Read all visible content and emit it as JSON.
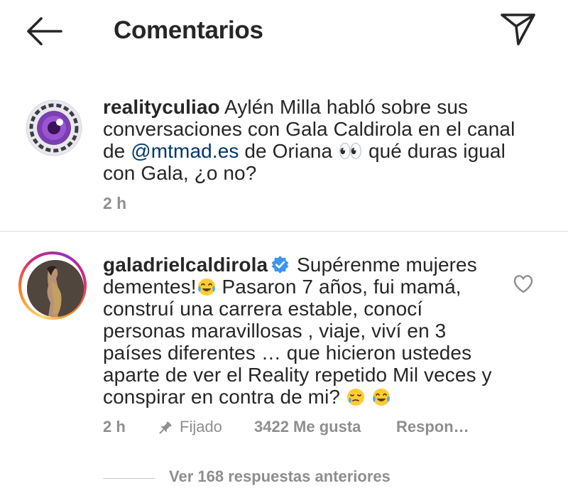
{
  "header": {
    "title": "Comentarios",
    "back_icon": "arrow-left-icon",
    "send_icon": "paper-plane-icon"
  },
  "caption": {
    "username": "realityculiao",
    "text_1": " Aylén Milla habló sobre sus conversaciones con Gala Caldirola en el canal de ",
    "mention": "@mtmad.es",
    "text_2": " de Oriana 👀 qué duras igual con Gala, ¿o no?",
    "time": "2 h"
  },
  "comment": {
    "username": "galadrielcaldirola",
    "verified": true,
    "text_1": " Supérenme mujeres dementes!",
    "text_2": " Pasaron 7 años, fui mamá, construí una carrera estable, conocí personas maravillosas , viaje, viví en 3 países diferentes … que hicieron ustedes aparte de ver el Reality repetido Mil veces y conspirar en contra de mi? ",
    "emojis": [
      "face-with-tears-of-joy",
      "sleepy-face",
      "face-with-tears-of-joy"
    ],
    "time": "2 h",
    "pinned_label": "Fijado",
    "likes": "3422 Me gusta",
    "reply_label": "Respon…",
    "heart_icon": "heart-outline-icon"
  },
  "replies": {
    "label": "Ver 168 respuestas anteriores"
  },
  "colors": {
    "text": "#262626",
    "secondary": "#8e8e8e",
    "mention": "#00376b",
    "verified": "#3897f0",
    "divider": "#dbdbdb"
  }
}
